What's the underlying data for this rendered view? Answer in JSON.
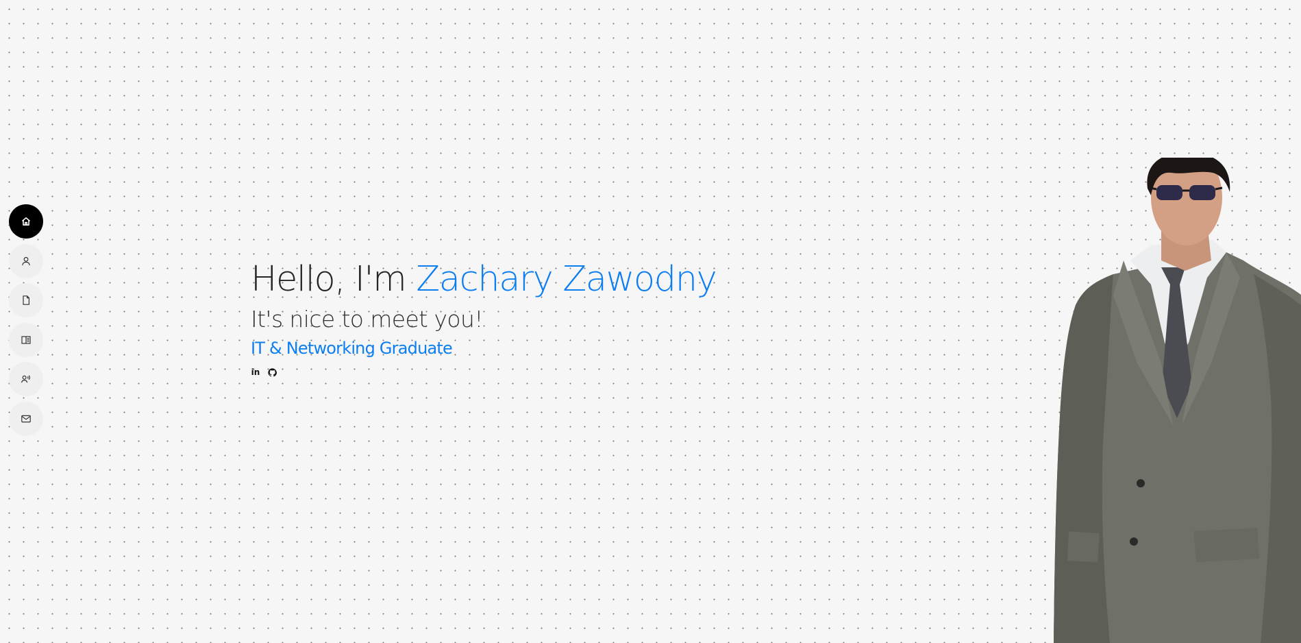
{
  "nav": {
    "items": [
      {
        "name": "home",
        "icon": "home-icon",
        "active": true
      },
      {
        "name": "about",
        "icon": "user-icon",
        "active": false
      },
      {
        "name": "resume",
        "icon": "file-icon",
        "active": false
      },
      {
        "name": "portfolio",
        "icon": "book-icon",
        "active": false
      },
      {
        "name": "services",
        "icon": "speaker-user-icon",
        "active": false
      },
      {
        "name": "contact",
        "icon": "mail-icon",
        "active": false
      }
    ]
  },
  "hero": {
    "greeting": "Hello, I'm ",
    "name": "Zachary Zawodny",
    "subtitle": "It's nice to meet you!",
    "role": "IT & Networking Graduate",
    "socials": [
      {
        "name": "linkedin",
        "icon": "linkedin-icon",
        "glyph": "in"
      },
      {
        "name": "github",
        "icon": "github-icon"
      }
    ]
  },
  "colors": {
    "accent": "#0d7ef0",
    "text": "#262626",
    "background": "#f6f6f6",
    "nav_active": "#000000",
    "nav_inactive": "#efefef"
  }
}
